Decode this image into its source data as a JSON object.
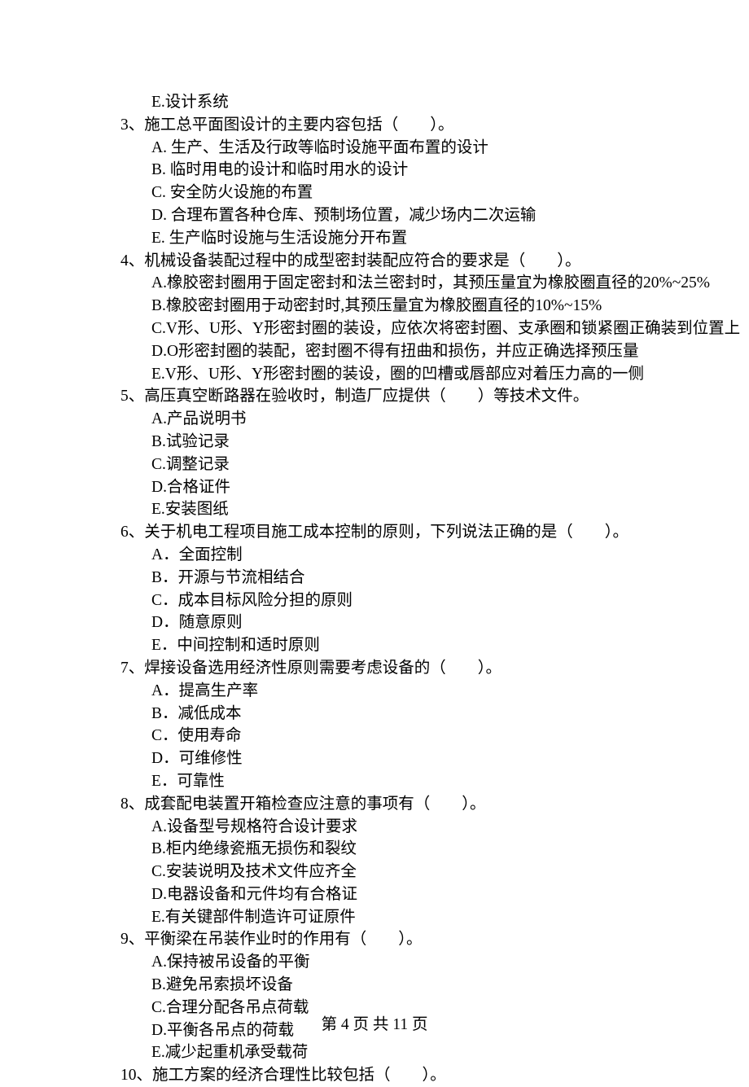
{
  "lines": [
    {
      "cls": "opt-indent",
      "t": "E.设计系统"
    },
    {
      "cls": "",
      "t": "3、施工总平面图设计的主要内容包括（　　）。"
    },
    {
      "cls": "opt-indent",
      "t": "A. 生产、生活及行政等临时设施平面布置的设计"
    },
    {
      "cls": "opt-indent",
      "t": "B. 临时用电的设计和临时用水的设计"
    },
    {
      "cls": "opt-indent",
      "t": "C. 安全防火设施的布置"
    },
    {
      "cls": "opt-indent",
      "t": "D. 合理布置各种仓库、预制场位置，减少场内二次运输"
    },
    {
      "cls": "opt-indent",
      "t": "E. 生产临时设施与生活设施分开布置"
    },
    {
      "cls": "",
      "t": "4、机械设备装配过程中的成型密封装配应符合的要求是（　　）。"
    },
    {
      "cls": "opt-indent",
      "t": "A.橡胶密封圈用于固定密封和法兰密封时，其预压量宜为橡胶圈直径的20%~25%"
    },
    {
      "cls": "opt-indent",
      "t": "B.橡胶密封圈用于动密封时,其预压量宜为橡胶圈直径的10%~15%"
    },
    {
      "cls": "opt-indent",
      "t": "C.V形、U形、Y形密封圈的装设，应依次将密封圈、支承圈和锁紧圈正确装到位置上"
    },
    {
      "cls": "opt-indent",
      "t": "D.O形密封圈的装配，密封圈不得有扭曲和损伤，并应正确选择预压量"
    },
    {
      "cls": "opt-indent",
      "t": "E.V形、U形、Y形密封圈的装设，圈的凹槽或唇部应对着压力高的一侧"
    },
    {
      "cls": "",
      "t": "5、高压真空断路器在验收时，制造厂应提供（　　）等技术文件。"
    },
    {
      "cls": "opt-indent",
      "t": "A.产品说明书"
    },
    {
      "cls": "opt-indent",
      "t": "B.试验记录"
    },
    {
      "cls": "opt-indent",
      "t": "C.调整记录"
    },
    {
      "cls": "opt-indent",
      "t": "D.合格证件"
    },
    {
      "cls": "opt-indent",
      "t": "E.安装图纸"
    },
    {
      "cls": "",
      "t": "6、关于机电工程项目施工成本控制的原则，下列说法正确的是（　　）。"
    },
    {
      "cls": "opt-indent",
      "t": "A．全面控制"
    },
    {
      "cls": "opt-indent",
      "t": "B．开源与节流相结合"
    },
    {
      "cls": "opt-indent",
      "t": "C．成本目标风险分担的原则"
    },
    {
      "cls": "opt-indent",
      "t": "D．随意原则"
    },
    {
      "cls": "opt-indent",
      "t": "E．中间控制和适时原则"
    },
    {
      "cls": "",
      "t": "7、焊接设备选用经济性原则需要考虑设备的（　　）。"
    },
    {
      "cls": "opt-indent",
      "t": "A．提高生产率"
    },
    {
      "cls": "opt-indent",
      "t": "B．减低成本"
    },
    {
      "cls": "opt-indent",
      "t": "C．使用寿命"
    },
    {
      "cls": "opt-indent",
      "t": "D．可维修性"
    },
    {
      "cls": "opt-indent",
      "t": "E．可靠性"
    },
    {
      "cls": "",
      "t": "8、成套配电装置开箱检查应注意的事项有（　　）。"
    },
    {
      "cls": "opt-indent",
      "t": "A.设备型号规格符合设计要求"
    },
    {
      "cls": "opt-indent",
      "t": "B.柜内绝缘瓷瓶无损伤和裂纹"
    },
    {
      "cls": "opt-indent",
      "t": "C.安装说明及技术文件应齐全"
    },
    {
      "cls": "opt-indent",
      "t": "D.电器设备和元件均有合格证"
    },
    {
      "cls": "opt-indent",
      "t": "E.有关键部件制造许可证原件"
    },
    {
      "cls": "",
      "t": "9、平衡梁在吊装作业时的作用有（　　）。"
    },
    {
      "cls": "opt-indent",
      "t": "A.保持被吊设备的平衡"
    },
    {
      "cls": "opt-indent",
      "t": "B.避免吊索损坏设备"
    },
    {
      "cls": "opt-indent",
      "t": "C.合理分配各吊点荷载"
    },
    {
      "cls": "opt-indent",
      "t": "D.平衡各吊点的荷载"
    },
    {
      "cls": "opt-indent",
      "t": "E.减少起重机承受载荷"
    },
    {
      "cls": "",
      "t": "10、施工方案的经济合理性比较包括（　　）。"
    }
  ],
  "footer": "第 4 页 共 11 页"
}
